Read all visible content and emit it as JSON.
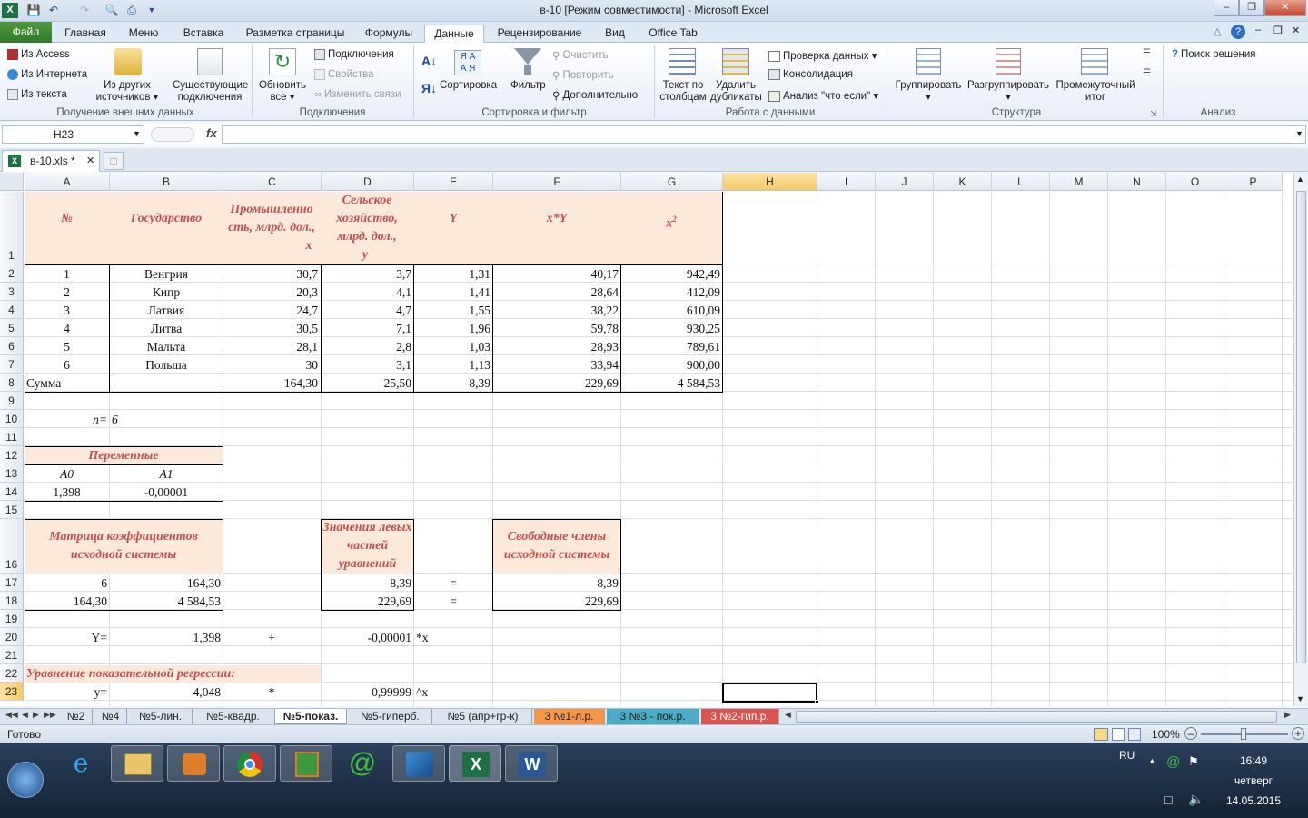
{
  "window": {
    "title": "в-10  [Режим совместимости]  -  Microsoft Excel"
  },
  "tabs": [
    "Файл",
    "Главная",
    "Меню",
    "Вставка",
    "Разметка страницы",
    "Формулы",
    "Данные",
    "Рецензирование",
    "Вид",
    "Office Tab"
  ],
  "ribbon": {
    "ext": {
      "access": "Из Access",
      "internet": "Из Интернета",
      "text": "Из текста",
      "other1": "Из других",
      "other2": "источников",
      "exist1": "Существующие",
      "exist2": "подключения",
      "group": "Получение внешних данных"
    },
    "conn": {
      "refresh1": "Обновить",
      "refresh2": "все",
      "connections": "Подключения",
      "props": "Свойства",
      "links": "Изменить связи",
      "group": "Подключения"
    },
    "sort": {
      "sort": "Сортировка",
      "filter": "Фильтр",
      "clear": "Очистить",
      "reapply": "Повторить",
      "advanced": "Дополнительно",
      "group": "Сортировка и фильтр"
    },
    "tools": {
      "ttc1": "Текст по",
      "ttc2": "столбцам",
      "rd1": "Удалить",
      "rd2": "дубликаты",
      "validation": "Проверка данных",
      "consolidate": "Консолидация",
      "whatif": "Анализ \"что если\"",
      "group": "Работа с данными"
    },
    "outline": {
      "group_btn": "Группировать",
      "ungroup": "Разгруппировать",
      "sub1": "Промежуточный",
      "sub2": "итог",
      "group": "Структура"
    },
    "analysis": {
      "solver": "Поиск решения",
      "group": "Анализ"
    }
  },
  "namebox": "H23",
  "fx": "fx",
  "doc_tab": "в-10.xls *",
  "columns": [
    "A",
    "B",
    "C",
    "D",
    "E",
    "F",
    "G",
    "H",
    "I",
    "J",
    "K",
    "L",
    "M",
    "N",
    "O",
    "P"
  ],
  "rows": [
    "1",
    "2",
    "3",
    "4",
    "5",
    "6",
    "7",
    "8",
    "9",
    "10",
    "11",
    "12",
    "13",
    "14",
    "15",
    "16",
    "17",
    "18",
    "19",
    "20",
    "21",
    "22",
    "23"
  ],
  "header": {
    "num": "№",
    "country": "Государство",
    "ind": "Промышленно сть, млрд. дол.,",
    "ind_x": "x",
    "agr": "Сельское хозяйство, млрд. дол.,",
    "agr_y": "y",
    "Y": "Y",
    "xY": "x*Y",
    "x2": "x",
    "x2_sup": "2"
  },
  "table": [
    [
      "1",
      "Венгрия",
      "30,7",
      "3,7",
      "1,31",
      "40,17",
      "942,49"
    ],
    [
      "2",
      "Кипр",
      "20,3",
      "4,1",
      "1,41",
      "28,64",
      "412,09"
    ],
    [
      "3",
      "Латвия",
      "24,7",
      "4,7",
      "1,55",
      "38,22",
      "610,09"
    ],
    [
      "4",
      "Литва",
      "30,5",
      "7,1",
      "1,96",
      "59,78",
      "930,25"
    ],
    [
      "5",
      "Мальта",
      "28,1",
      "2,8",
      "1,03",
      "28,93",
      "789,61"
    ],
    [
      "6",
      "Польша",
      "30",
      "3,1",
      "1,13",
      "33,94",
      "900,00"
    ]
  ],
  "sum": {
    "label": "Сумма",
    "c": "164,30",
    "d": "25,50",
    "e": "8,39",
    "f": "229,69",
    "g": "4 584,53"
  },
  "n": {
    "label": "n=",
    "value": "6"
  },
  "vars": {
    "title": "Переменные",
    "a0": "A0",
    "a1": "A1",
    "a0_val": "1,398",
    "a1_val": "-0,00001"
  },
  "matrix": {
    "title": "Матрица коэффициентов исходной системы",
    "r17": [
      "6",
      "164,30"
    ],
    "r18": [
      "164,30",
      "4 584,53"
    ]
  },
  "left": {
    "title": "Значения левых частей уравнений",
    "r17": "8,39",
    "r18": "229,69"
  },
  "eq": "=",
  "free": {
    "title": "Свободные члены исходной системы",
    "r17": "8,39",
    "r18": "229,69"
  },
  "row20": {
    "a": "Y=",
    "b": "1,398",
    "c": "+",
    "d": "-0,00001",
    "e": "*x"
  },
  "row22": "Уравнение показательной регрессии:",
  "row23": {
    "a": "y=",
    "b": "4,048",
    "c": "*",
    "d": "0,99999",
    "e": "^x"
  },
  "sheets": [
    "№2",
    "№4",
    "№5-лин.",
    "№5-квадр.",
    "№5-показ.",
    "№5-гиперб.",
    "№5 (апр+гр-к)",
    "3 №1-л.р.",
    "3 №3 - пок.р.",
    "3 №2-гип.р."
  ],
  "status": {
    "ready": "Готово",
    "zoom": "100%"
  },
  "taskbar": {
    "lang": "RU",
    "time": "16:49",
    "day": "четверг",
    "date": "14.05.2015"
  },
  "colors": {
    "header_fill": "#fde9d9",
    "header_text": "#c0504d",
    "selected_header": "#f6c965"
  }
}
